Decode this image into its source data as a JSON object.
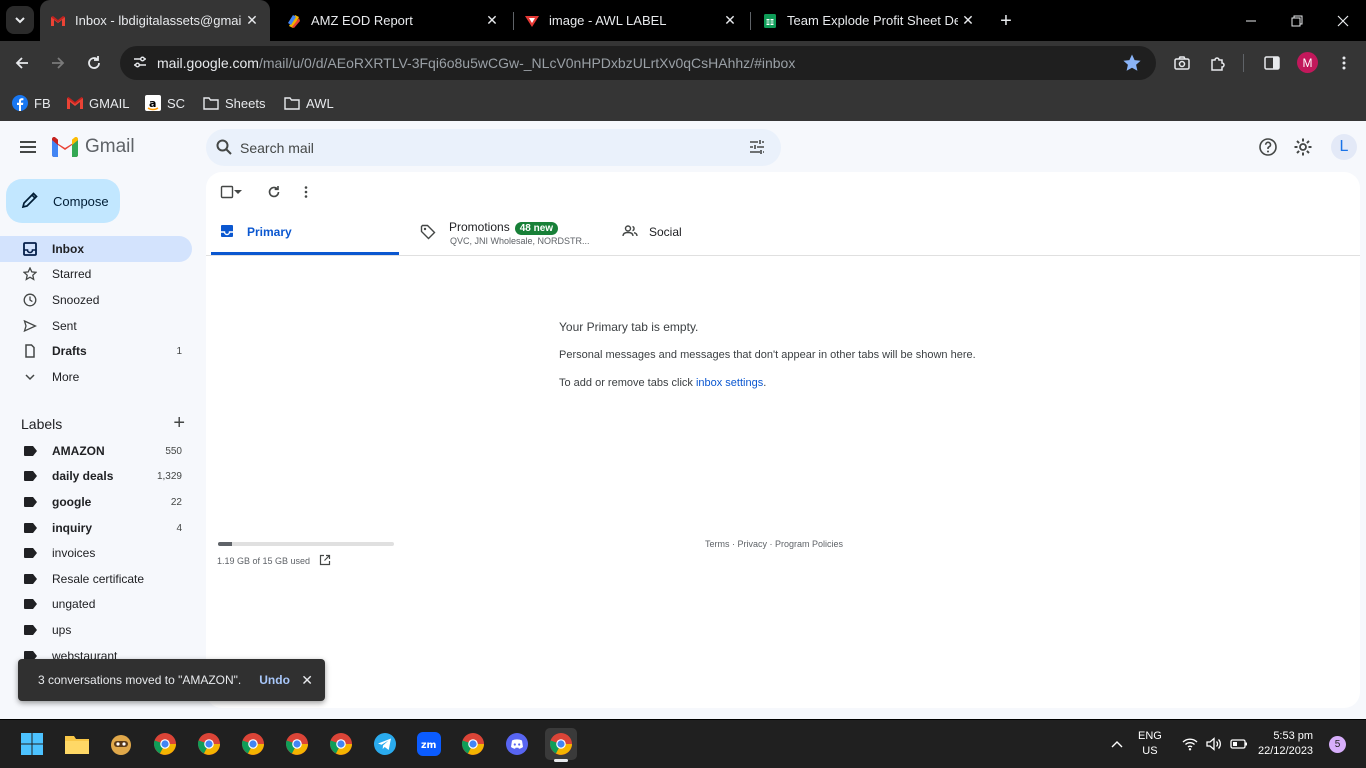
{
  "browser": {
    "tabs": [
      {
        "title": "Inbox - lbdigitalassets@gmail.com",
        "active": true,
        "icon": "gmail-icon"
      },
      {
        "title": "AMZ EOD Report",
        "active": false,
        "icon": "report-app-icon"
      },
      {
        "title": "image - AWL LABEL",
        "active": false,
        "icon": "awl-label-icon"
      },
      {
        "title": "Team Explode Profit Sheet Dec",
        "active": false,
        "icon": "google-sheets-icon"
      }
    ],
    "url_host": "mail.google.com",
    "url_path": "/mail/u/0/d/AEoRXRTLV-3Fqi6o8u5wCGw-_NLcV0nHPDxbzULrtXv0qCsHAhhz/#inbox",
    "profile_initial": "M",
    "bookmarks": [
      {
        "label": "FB",
        "icon": "facebook-icon"
      },
      {
        "label": "GMAIL",
        "icon": "gmail-icon"
      },
      {
        "label": "SC",
        "icon": "amazon-icon"
      },
      {
        "label": "Sheets",
        "icon": "folder-icon"
      },
      {
        "label": "AWL",
        "icon": "folder-icon"
      }
    ]
  },
  "gmail": {
    "brand": "Gmail",
    "search_placeholder": "Search mail",
    "account_initial": "L",
    "compose_label": "Compose",
    "nav": [
      {
        "label": "Inbox",
        "count": "",
        "icon": "inbox-icon"
      },
      {
        "label": "Starred",
        "count": "",
        "icon": "star-icon"
      },
      {
        "label": "Snoozed",
        "count": "",
        "icon": "clock-icon"
      },
      {
        "label": "Sent",
        "count": "",
        "icon": "send-icon"
      },
      {
        "label": "Drafts",
        "count": "1",
        "icon": "draft-icon"
      },
      {
        "label": "More",
        "count": "",
        "icon": "chevron-down-icon"
      }
    ],
    "labels_title": "Labels",
    "labels": [
      {
        "label": "AMAZON",
        "count": "550",
        "bold": true
      },
      {
        "label": "daily deals",
        "count": "1,329",
        "bold": true
      },
      {
        "label": "google",
        "count": "22",
        "bold": true
      },
      {
        "label": "inquiry",
        "count": "4",
        "bold": true
      },
      {
        "label": "invoices",
        "count": "",
        "bold": false
      },
      {
        "label": "Resale certificate",
        "count": "",
        "bold": false
      },
      {
        "label": "ungated",
        "count": "",
        "bold": false
      },
      {
        "label": "ups",
        "count": "",
        "bold": false
      },
      {
        "label": "webstaurant",
        "count": "",
        "bold": false
      }
    ],
    "category_tabs": {
      "primary": "Primary",
      "promotions": "Promotions",
      "promotions_badge": "48 new",
      "promotions_senders": "QVC, JNI Wholesale, NORDSTR...",
      "social": "Social"
    },
    "empty_state": {
      "title": "Your Primary tab is empty.",
      "subtitle": "Personal messages and messages that don't appear in other tabs will be shown here.",
      "tabs_text": "To add or remove tabs click ",
      "tabs_link": "inbox settings",
      "tabs_end": "."
    },
    "storage": {
      "text": "1.19 GB of 15 GB used",
      "used_fraction": 0.079
    },
    "footer": "Terms · Privacy · Program Policies",
    "toast": {
      "message": "3 conversations moved to \"AMAZON\".",
      "action": "Undo"
    }
  },
  "taskbar": {
    "lang_line1": "ENG",
    "lang_line2": "US",
    "time": "5:53 pm",
    "date": "22/12/2023",
    "notifications": "5",
    "apps": [
      "windows-start-icon",
      "file-explorer-icon",
      "app-icon",
      "chrome-icon",
      "chrome-icon",
      "chrome-icon",
      "chrome-icon",
      "chrome-icon",
      "telegram-icon",
      "zoom-icon",
      "chrome-icon",
      "discord-icon",
      "chrome-icon"
    ]
  }
}
